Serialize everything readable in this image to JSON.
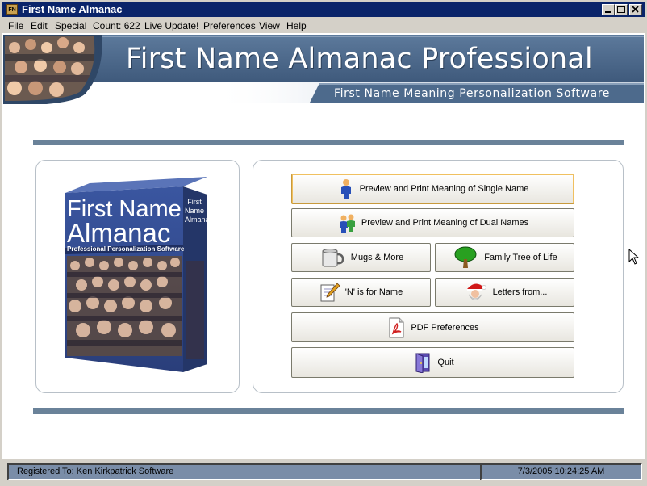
{
  "window": {
    "title": "First Name Almanac"
  },
  "menu": [
    {
      "label": "File"
    },
    {
      "label": "Edit"
    },
    {
      "label": "Special"
    },
    {
      "label": "Count: 622"
    },
    {
      "label": "Live Update!"
    },
    {
      "label": "Preferences"
    },
    {
      "label": "View"
    },
    {
      "label": "Help"
    }
  ],
  "banner": {
    "title": "First Name Almanac Professional",
    "subtitle": "First Name Meaning Personalization Software"
  },
  "box": {
    "line1": "First Name",
    "line2": "Almanac",
    "tagline": "Professional Personalization Software",
    "spine": "First Name Almanac"
  },
  "buttons": {
    "single": "Preview and Print Meaning of Single Name",
    "dual": "Preview and Print Meaning of Dual Names",
    "mugs": "Mugs & More",
    "tree": "Family Tree of Life",
    "n_for_name": "'N' is for Name",
    "letters": "Letters from...",
    "pdf": "PDF Preferences",
    "quit": "Quit"
  },
  "status": {
    "registered": "Registered To:  Ken Kirkpatrick Software",
    "datetime": "7/3/2005 10:24:25 AM"
  },
  "colors": {
    "title_bar": "#0a246a",
    "banner_blue": "#4d6a8c",
    "rule": "#6a8299",
    "status_panel": "#7a8da8"
  }
}
